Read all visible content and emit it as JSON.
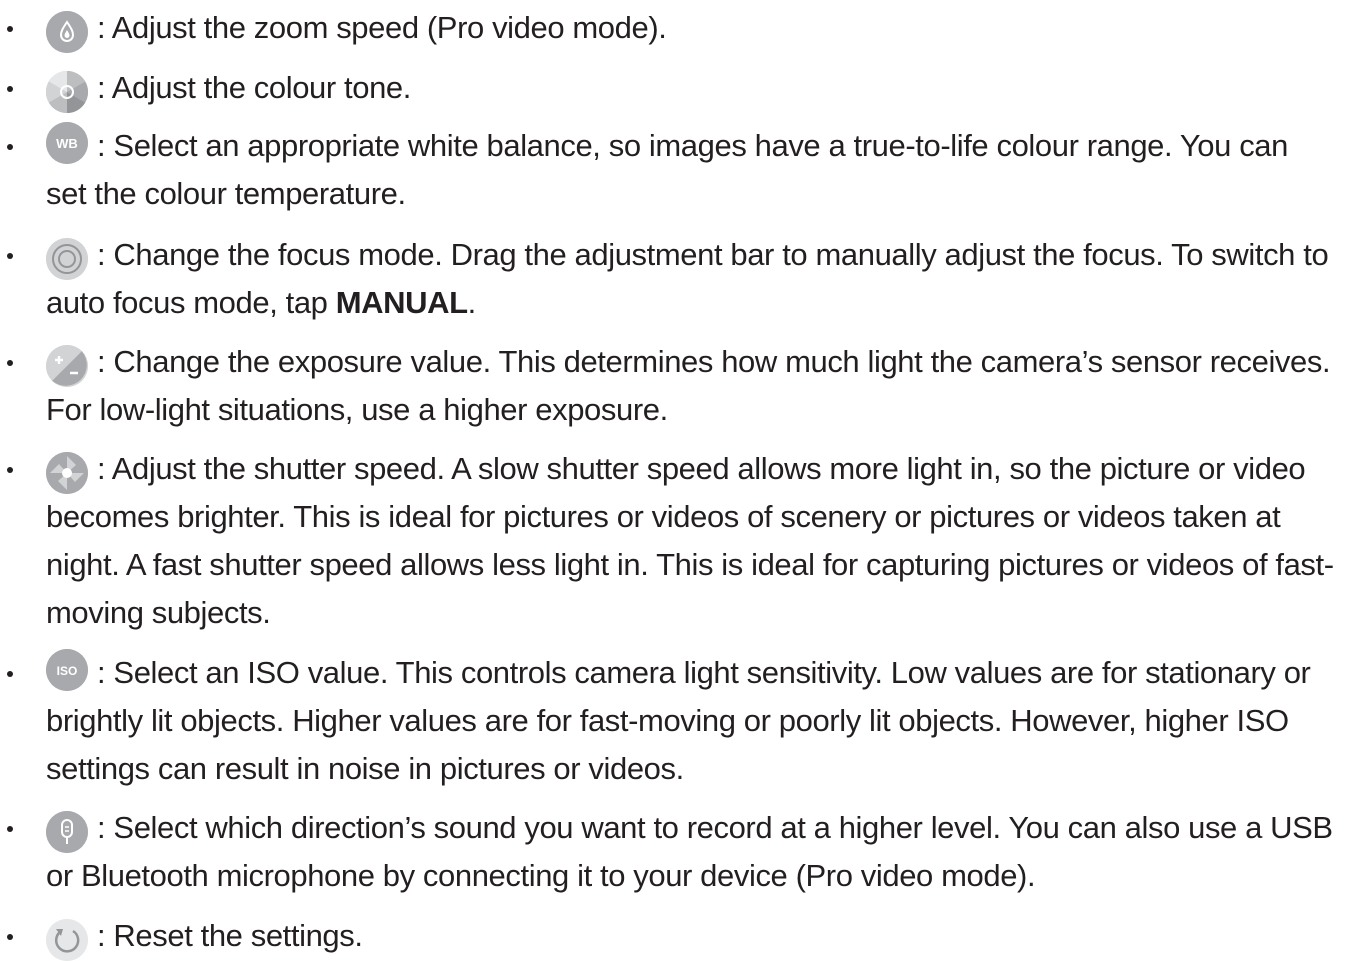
{
  "items": [
    {
      "icon": "zoom-speed-icon",
      "text": ": Adjust the zoom speed (Pro video mode)."
    },
    {
      "icon": "colour-tone-icon",
      "text": ": Adjust the colour tone."
    },
    {
      "icon": "white-balance-icon",
      "icon_label": "WB",
      "text": ": Select an appropriate white balance, so images have a true-to-life colour range. You can set the colour temperature."
    },
    {
      "icon": "focus-mode-icon",
      "text_before": ": Change the focus mode. Drag the adjustment bar to manually adjust the focus. To switch to auto focus mode, tap ",
      "bold": "MANUAL",
      "text_after": "."
    },
    {
      "icon": "exposure-value-icon",
      "text": ": Change the exposure value. This determines how much light the camera’s sensor receives. For low-light situations, use a higher exposure."
    },
    {
      "icon": "shutter-speed-icon",
      "text": ": Adjust the shutter speed. A slow shutter speed allows more light in, so the picture or video becomes brighter. This is ideal for pictures or videos of scenery or pictures or videos taken at night. A fast shutter speed allows less light in. This is ideal for capturing pictures or videos of fast-moving subjects."
    },
    {
      "icon": "iso-icon",
      "icon_label": "ISO",
      "text": ": Select an ISO value. This controls camera light sensitivity. Low values are for stationary or brightly lit objects. Higher values are for fast-moving or poorly lit objects. However, higher ISO settings can result in noise in pictures or videos."
    },
    {
      "icon": "microphone-icon",
      "text": ": Select which direction’s sound you want to record at a higher level. You can also use a USB or Bluetooth microphone by connecting it to your device (Pro video mode)."
    },
    {
      "icon": "reset-icon",
      "text": ": Reset the settings."
    }
  ],
  "colors": {
    "text": "#231f20",
    "icon_fill": "#a7a9ac",
    "icon_light": "#d1d3d4"
  }
}
